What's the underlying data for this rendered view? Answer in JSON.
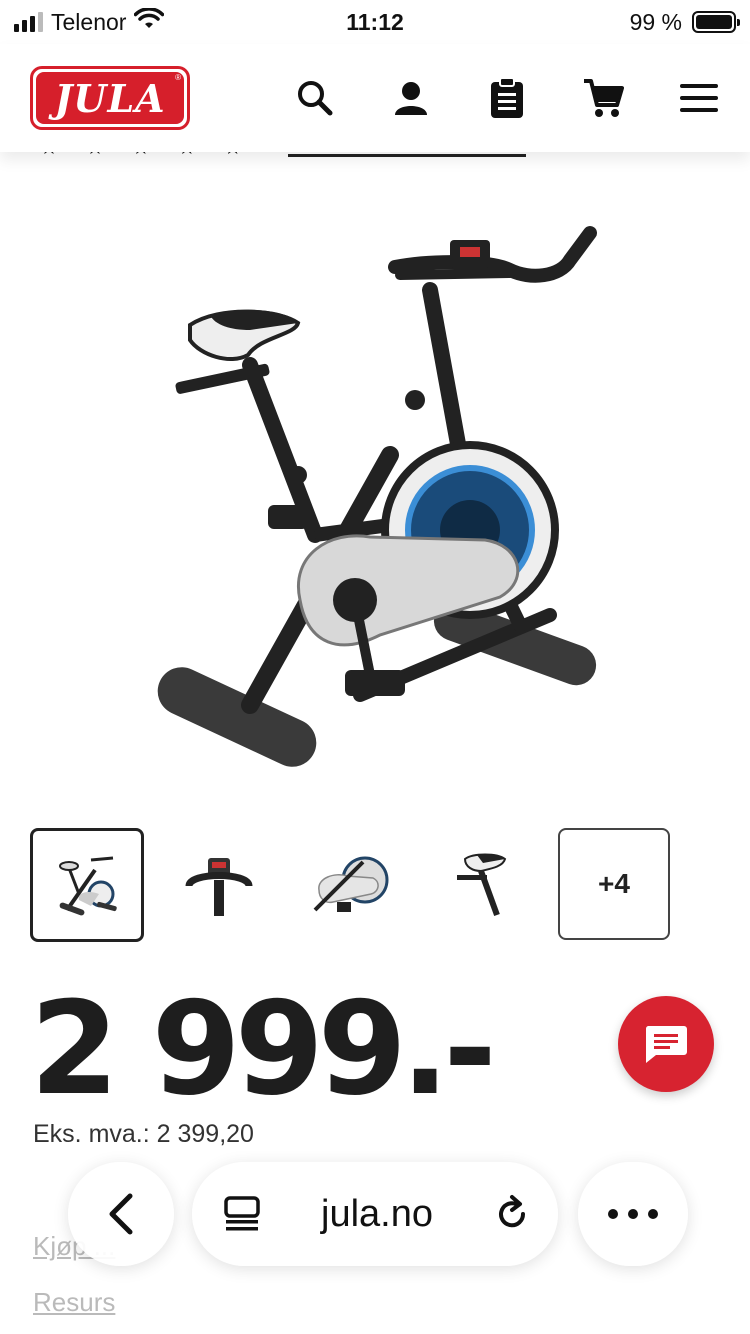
{
  "status_bar": {
    "carrier": "Telenor",
    "time": "11:12",
    "battery": "99 %",
    "battery_level": 0.99
  },
  "header": {
    "logo_text": "JULA",
    "logo_mark": "®",
    "icons": [
      "search-icon",
      "account-icon",
      "shopping-list-icon",
      "cart-icon",
      "menu-icon"
    ]
  },
  "product": {
    "image": "exercise-bike",
    "thumbnails": [
      "bike-full",
      "bike-console",
      "bike-flywheel",
      "bike-seat"
    ],
    "more_thumbnails_label": "+4",
    "price": "2 999.-",
    "ex_vat_label": "Eks. mva.: 2 399,20"
  },
  "colors": {
    "brand_red": "#d61f2b",
    "chat_red": "#d72330"
  },
  "faded_links": [
    "Kjøp ... ",
    "Resurs"
  ],
  "safari": {
    "url": "jula.no"
  }
}
